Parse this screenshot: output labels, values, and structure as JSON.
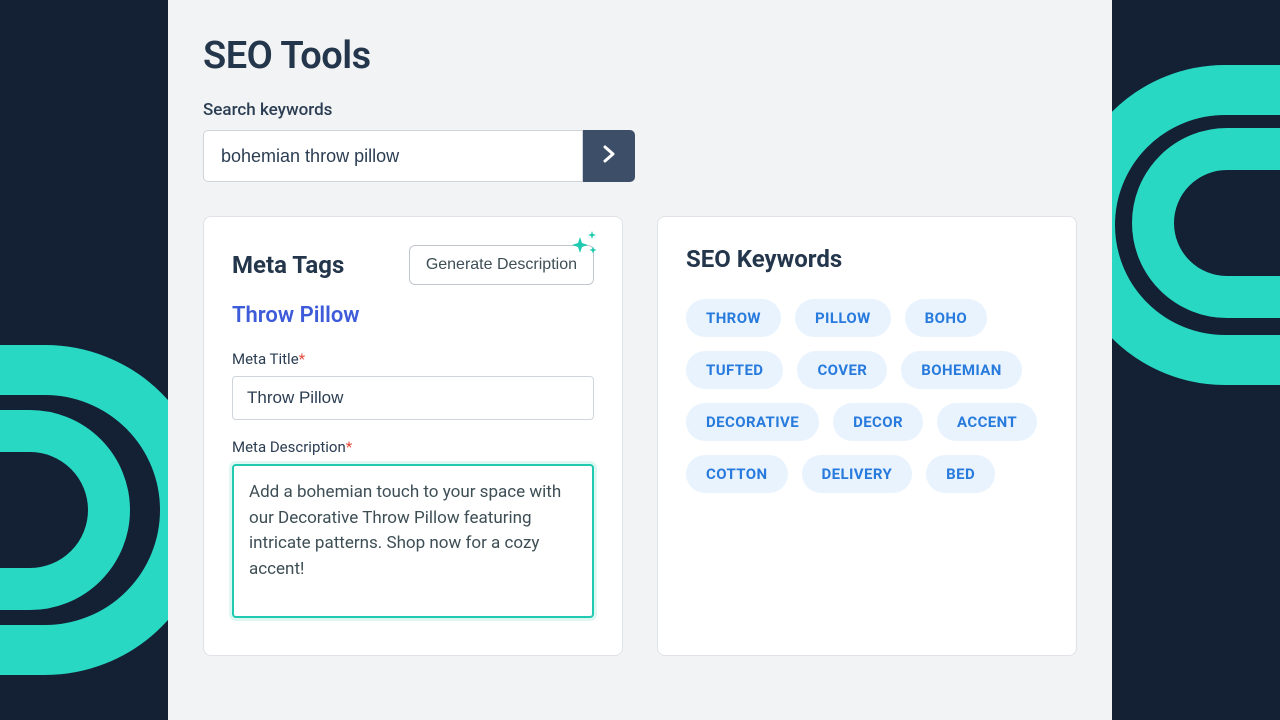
{
  "page": {
    "title": "SEO Tools"
  },
  "search": {
    "label": "Search keywords",
    "value": "bohemian throw pillow"
  },
  "meta": {
    "heading": "Meta Tags",
    "generate_label": "Generate Description",
    "subheading": "Throw Pillow",
    "title_label": "Meta Title",
    "title_value": "Throw Pillow",
    "desc_label": "Meta Description",
    "desc_value": "Add a bohemian touch to your space with our Decorative Throw Pillow featuring intricate patterns. Shop now for a cozy accent!"
  },
  "seo": {
    "heading": "SEO Keywords",
    "keywords": [
      "THROW",
      "PILLOW",
      "BOHO",
      "TUFTED",
      "COVER",
      "BOHEMIAN",
      "DECORATIVE",
      "DECOR",
      "ACCENT",
      "COTTON",
      "DELIVERY",
      "BED"
    ]
  },
  "colors": {
    "accent_teal": "#28d8c3",
    "keyword_blue": "#287bdc",
    "link_purple": "#3e5bd9",
    "required": "#e24a3b"
  }
}
